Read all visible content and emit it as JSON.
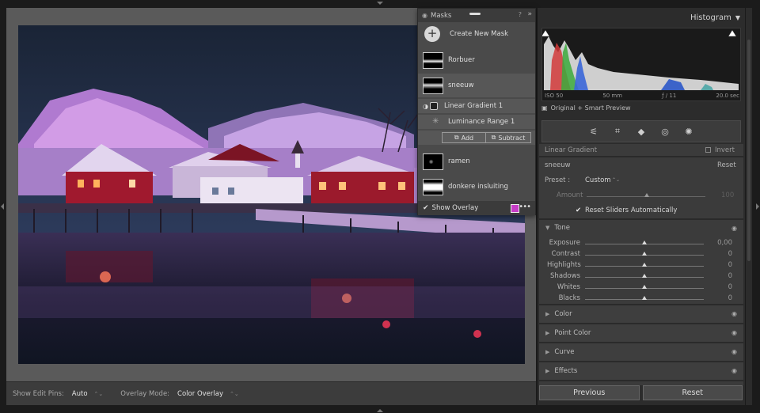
{
  "canvas": {
    "bottom_toolbar": {
      "show_edit_pins_label": "Show Edit Pins:",
      "show_edit_pins_value": "Auto",
      "overlay_mode_label": "Overlay Mode:",
      "overlay_mode_value": "Color Overlay",
      "stepper_glyph": "⌃⌄"
    }
  },
  "masks": {
    "title": "Masks",
    "help_icon": "?",
    "collapse_icon": "»",
    "create_label": "Create New Mask",
    "items": [
      {
        "name": "Rorbuer"
      },
      {
        "name": "sneeuw"
      },
      {
        "name": "Linear Gradient 1"
      },
      {
        "name": "Luminance Range 1"
      },
      {
        "name": "ramen"
      },
      {
        "name": "donkere insluiting"
      }
    ],
    "add_label": "Add",
    "subtract_label": "Subtract",
    "show_overlay_label": "Show Overlay",
    "show_overlay_checked": true,
    "overlay_color": "#c63cc6",
    "more_glyph": "•••"
  },
  "histogram": {
    "title": "Histogram",
    "iso": "ISO 50",
    "focal": "50 mm",
    "aperture": "ƒ / 11",
    "shutter": "20.0 sec",
    "preview": "Original + Smart Preview"
  },
  "panel": {
    "linear_gradient_label": "Linear Gradient",
    "invert_label": "Invert",
    "mask_name": "sneeuw",
    "reset_label": "Reset",
    "preset_label": "Preset :",
    "preset_value": "Custom",
    "amount_label": "Amount",
    "amount_value": "100",
    "reset_sliders_label": "Reset Sliders Automatically",
    "tone_label": "Tone",
    "sliders": [
      {
        "label": "Exposure",
        "value": "0,00",
        "position": 0.5
      },
      {
        "label": "Contrast",
        "value": "0",
        "position": 0.5
      },
      {
        "label": "Highlights",
        "value": "0",
        "position": 0.5
      },
      {
        "label": "Shadows",
        "value": "0",
        "position": 0.5
      },
      {
        "label": "Whites",
        "value": "0",
        "position": 0.5
      },
      {
        "label": "Blacks",
        "value": "0",
        "position": 0.5
      }
    ],
    "sections": [
      "Color",
      "Point Color",
      "Curve",
      "Effects"
    ]
  },
  "footer": {
    "previous_label": "Previous",
    "reset_label": "Reset"
  }
}
